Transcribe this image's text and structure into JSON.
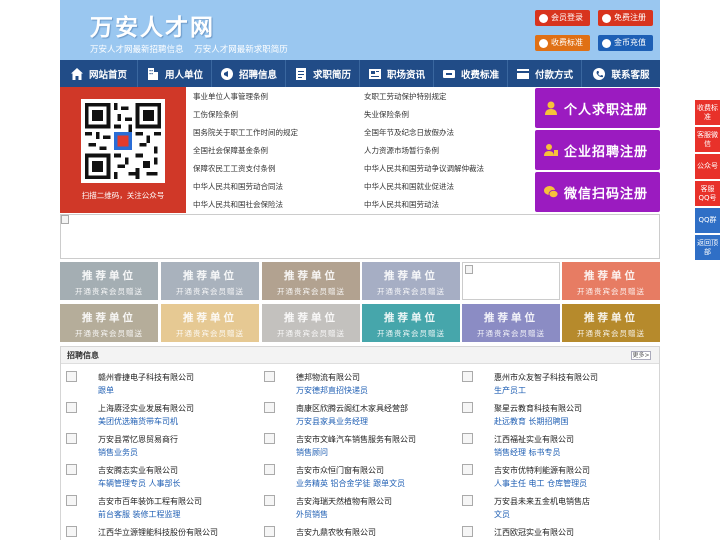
{
  "header": {
    "site_title": "万安人才网",
    "slogan_1": "万安人才网最新招聘信息",
    "slogan_2": "万安人才网最新求职简历",
    "buttons": [
      {
        "label": "会员登录",
        "color": "#d8341e"
      },
      {
        "label": "免费注册",
        "color": "#d8341e"
      },
      {
        "label": "收费标准",
        "color": "#e07015"
      },
      {
        "label": "金币充值",
        "color": "#1d5fb5"
      }
    ]
  },
  "nav": {
    "items": [
      {
        "label": "网站首页",
        "icon": "home-icon"
      },
      {
        "label": "用人单位",
        "icon": "building-icon"
      },
      {
        "label": "招聘信息",
        "icon": "megaphone-icon"
      },
      {
        "label": "求职简历",
        "icon": "resume-icon"
      },
      {
        "label": "职场资讯",
        "icon": "news-icon"
      },
      {
        "label": "收费标准",
        "icon": "ticket-icon"
      },
      {
        "label": "付款方式",
        "icon": "payment-icon"
      },
      {
        "label": "联系客服",
        "icon": "phone-icon"
      }
    ]
  },
  "qr": {
    "caption": "扫描二维码，关注公众号"
  },
  "links": {
    "left": [
      "事业单位人事管理条例",
      "工伤保险条例",
      "国务院关于职工工作时间的规定",
      "全国社会保障基金条例",
      "保障农民工工资支付条例",
      "中华人民共和国劳动合同法",
      "中华人民共和国社会保险法"
    ],
    "right": [
      "女职工劳动保护特别规定",
      "失业保险条例",
      "全国年节及纪念日放假办法",
      "人力资源市场暂行条例",
      "中华人民共和国劳动争议调解仲裁法",
      "中华人民共和国就业促进法",
      "中华人民共和国劳动法"
    ]
  },
  "register": {
    "personal": "个人求职注册",
    "company": "企业招聘注册",
    "wechat": "微信扫码注册",
    "color": "#9b1bc0"
  },
  "side": {
    "items": [
      "收费标准",
      "客服微信",
      "公众号",
      "客服QQ号",
      "QQ群",
      "返回顶部"
    ]
  },
  "ads": {
    "title": "推荐单位",
    "subtitle": "开通贵宾会员赠送",
    "row1_colors": [
      "#a4aeb3",
      "#a9b2bd",
      "#b2a290",
      "#a6aec4",
      "",
      "#e77c63"
    ],
    "row2_colors": [
      "#b5ad9a",
      "#e6c993",
      "#c3c1be",
      "#46a6ab",
      "#8b8cc4",
      "#b68a2c"
    ]
  },
  "jobs": {
    "title": "招聘信息",
    "more": "更多>",
    "listings": [
      {
        "company": "赣州睿捷电子科技有限公司",
        "positions": "跟单"
      },
      {
        "company": "德邦物流有限公司",
        "positions": "万安德邦直招快递员"
      },
      {
        "company": "惠州市众友智子科技有限公司",
        "positions": "生产员工"
      },
      {
        "company": "上海赓泾实业发展有限公司",
        "positions": "美团优选箱货带车司机"
      },
      {
        "company": "南康区欣腾云阁红木家具经营部",
        "positions": "万安县家具业务经理"
      },
      {
        "company": "聚星云教育科技有限公司",
        "positions": "赴远教育 长期招聘国"
      },
      {
        "company": "万安县常忆恩贸易商行",
        "positions": "销售业务员"
      },
      {
        "company": "吉安市文峰汽车销售服务有限公司",
        "positions": "销售顾问"
      },
      {
        "company": "江西福祉实业有限公司",
        "positions": "销售经理 标书专员"
      },
      {
        "company": "吉安腾志实业有限公司",
        "positions": "车辆管理专员 人事部长"
      },
      {
        "company": "吉安市众恒门窗有限公司",
        "positions": "业务精英 铝合金学徒 跟单文员"
      },
      {
        "company": "吉安市优特利能源有限公司",
        "positions": "人事主任 电工 仓库管理员"
      },
      {
        "company": "吉安市百年装饰工程有限公司",
        "positions": "前台客服 装修工程监理"
      },
      {
        "company": "吉安海瑞天然植物有限公司",
        "positions": "外贸销售"
      },
      {
        "company": "万安县未来五金机电销售店",
        "positions": "文员"
      },
      {
        "company": "江西华立源锂能科技股份有限公司",
        "positions": "电芯研发工程师 生产主管 机修技师"
      },
      {
        "company": "吉安九鼎农牧有限公司",
        "positions": "会计"
      },
      {
        "company": "江西欧冠实业有限公司",
        "positions": "会计 网络维护技术员"
      }
    ]
  }
}
